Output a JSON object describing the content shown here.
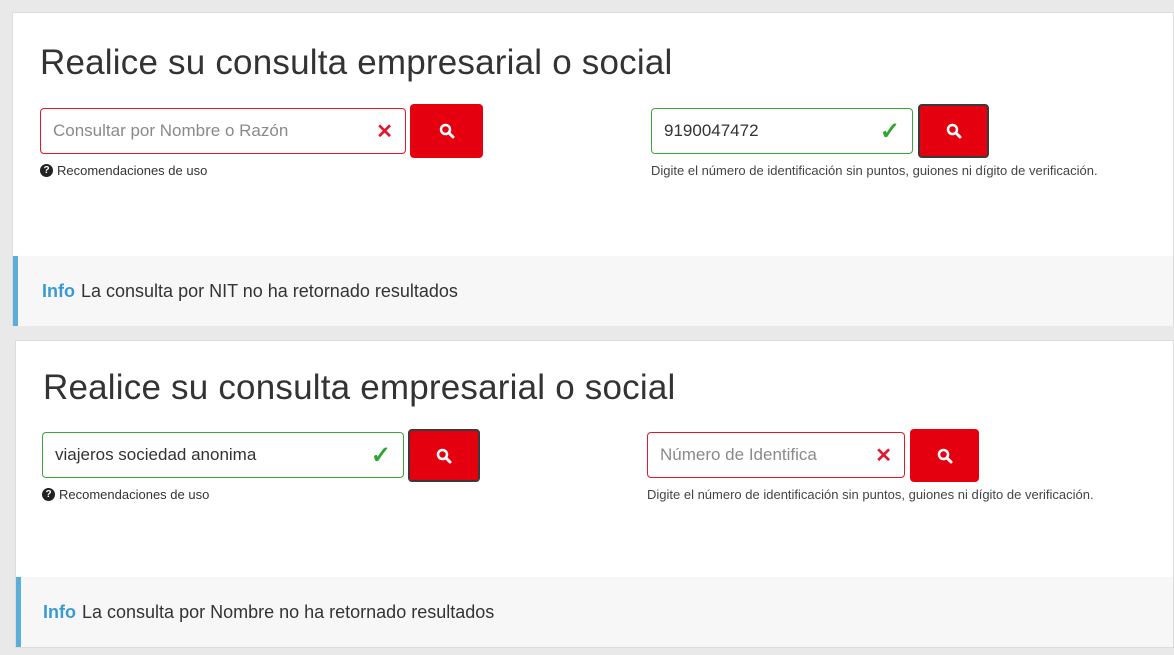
{
  "panels": [
    {
      "title": "Realice su consulta empresarial o social",
      "name_search": {
        "value": "",
        "placeholder": "Consultar por Nombre o Razón",
        "state": "invalid"
      },
      "help_link": "Recomendaciones de uso",
      "nit_search": {
        "value": "9190047472",
        "placeholder": "",
        "state": "valid"
      },
      "nit_hint": "Digite el número de identificación sin puntos, guiones ni dígito de verificación.",
      "info_label": "Info",
      "info_message": "La consulta por NIT no ha retornado resultados"
    },
    {
      "title": "Realice su consulta empresarial o social",
      "name_search": {
        "value": "viajeros sociedad anonima",
        "placeholder": "",
        "state": "valid"
      },
      "help_link": "Recomendaciones de uso",
      "nit_search": {
        "value": "",
        "placeholder": "Número de Identifica",
        "state": "invalid"
      },
      "nit_hint": "Digite el número de identificación sin puntos, guiones ni dígito de verificación.",
      "info_label": "Info",
      "info_message": "La consulta por Nombre no ha retornado resultados"
    }
  ],
  "icons": {
    "search": "search-icon",
    "clear": "x-icon",
    "valid": "check-icon",
    "help": "question-circle-icon"
  },
  "colors": {
    "brand_red": "#e5000f",
    "valid_green": "#3ca83c",
    "invalid_red": "#e0192f",
    "info_blue": "#3a9bd1"
  }
}
